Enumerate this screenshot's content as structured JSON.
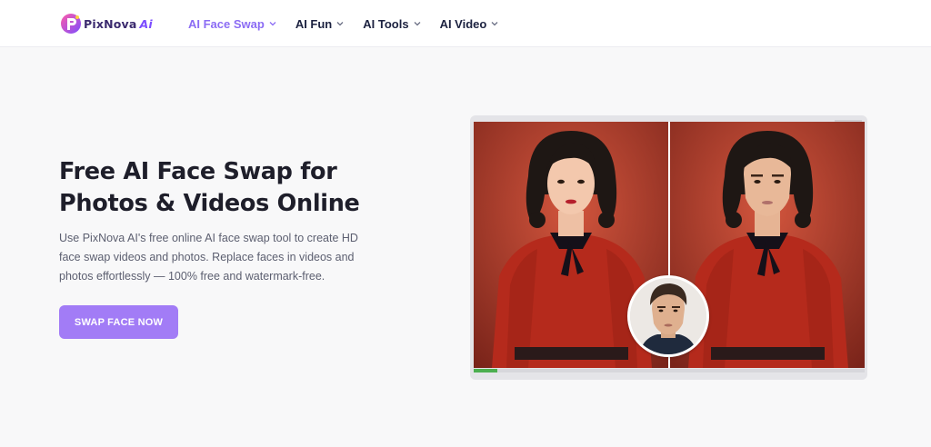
{
  "brand": {
    "name": "PixNova",
    "suffix": "Ai"
  },
  "nav": {
    "items": [
      {
        "label": "AI Face Swap",
        "active": true
      },
      {
        "label": "AI Fun",
        "active": false
      },
      {
        "label": "AI Tools",
        "active": false
      },
      {
        "label": "AI Video",
        "active": false
      }
    ]
  },
  "hero": {
    "title": "Free AI Face Swap for Photos & Videos Online",
    "description": "Use PixNova AI's free online AI face swap tool to create HD face swap videos and photos. Replace faces in videos and photos effortlessly — 100% free and watermark-free.",
    "cta": "SWAP FACE NOW"
  },
  "demo": {
    "progress": 0.06,
    "icons": [
      "logo-icon",
      "chevron-down-icon"
    ]
  },
  "colors": {
    "accent": "#a27cf6",
    "nav_active": "#8b6cf4",
    "nav_text": "#1c2240",
    "title": "#1e1e2a",
    "progress": "#4caf50"
  }
}
